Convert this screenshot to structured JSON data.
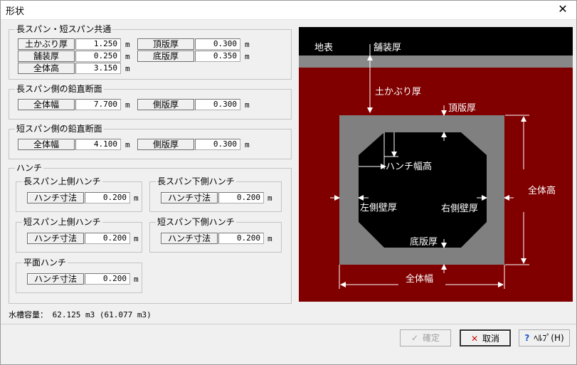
{
  "window": {
    "title": "形状",
    "close_glyph": "✕"
  },
  "common": {
    "legend": "長スパン・短スパン共通",
    "rows": [
      {
        "label": "土かぶり厚",
        "value": "1.250",
        "unit": "m"
      },
      {
        "label": "舗装厚",
        "value": "0.250",
        "unit": "m"
      },
      {
        "label": "全体高",
        "value": "3.150",
        "unit": "m"
      },
      {
        "label": "頂版厚",
        "value": "0.300",
        "unit": "m"
      },
      {
        "label": "底版厚",
        "value": "0.350",
        "unit": "m"
      }
    ]
  },
  "long_section": {
    "legend": "長スパン側の鉛直断面",
    "rows": [
      {
        "label": "全体幅",
        "value": "7.700",
        "unit": "m"
      },
      {
        "label": "側版厚",
        "value": "0.300",
        "unit": "m"
      }
    ]
  },
  "short_section": {
    "legend": "短スパン側の鉛直断面",
    "rows": [
      {
        "label": "全体幅",
        "value": "4.100",
        "unit": "m"
      },
      {
        "label": "側版厚",
        "value": "0.300",
        "unit": "m"
      }
    ]
  },
  "haunch": {
    "legend": "ハンチ",
    "groups": [
      {
        "legend": "長スパン上側ハンチ",
        "label": "ハンチ寸法",
        "value": "0.200",
        "unit": "m"
      },
      {
        "legend": "長スパン下側ハンチ",
        "label": "ハンチ寸法",
        "value": "0.200",
        "unit": "m"
      },
      {
        "legend": "短スパン上側ハンチ",
        "label": "ハンチ寸法",
        "value": "0.200",
        "unit": "m"
      },
      {
        "legend": "短スパン下側ハンチ",
        "label": "ハンチ寸法",
        "value": "0.200",
        "unit": "m"
      },
      {
        "legend": "平面ハンチ",
        "label": "ハンチ寸法",
        "value": "0.200",
        "unit": "m"
      }
    ]
  },
  "capacity": "水槽容量： 62.125 m3 (61.077 m3)",
  "buttons": {
    "ok": "確定",
    "cancel": "取消",
    "help": "ﾍﾙﾌﾟ(H)"
  },
  "diagram": {
    "labels": {
      "ground": "地表",
      "pavement": "舗装厚",
      "cover": "土かぶり厚",
      "top_slab": "頂版厚",
      "haunch": "ハンチ幅高",
      "total_height": "全体高",
      "left_wall": "左側壁厚",
      "right_wall": "右側壁厚",
      "bottom_slab": "底版厚",
      "total_width": "全体幅"
    },
    "colors": {
      "soil": "#800000",
      "ground_band": "#000000",
      "pavement": "#888888",
      "concrete": "#808080",
      "void": "#000000"
    }
  }
}
